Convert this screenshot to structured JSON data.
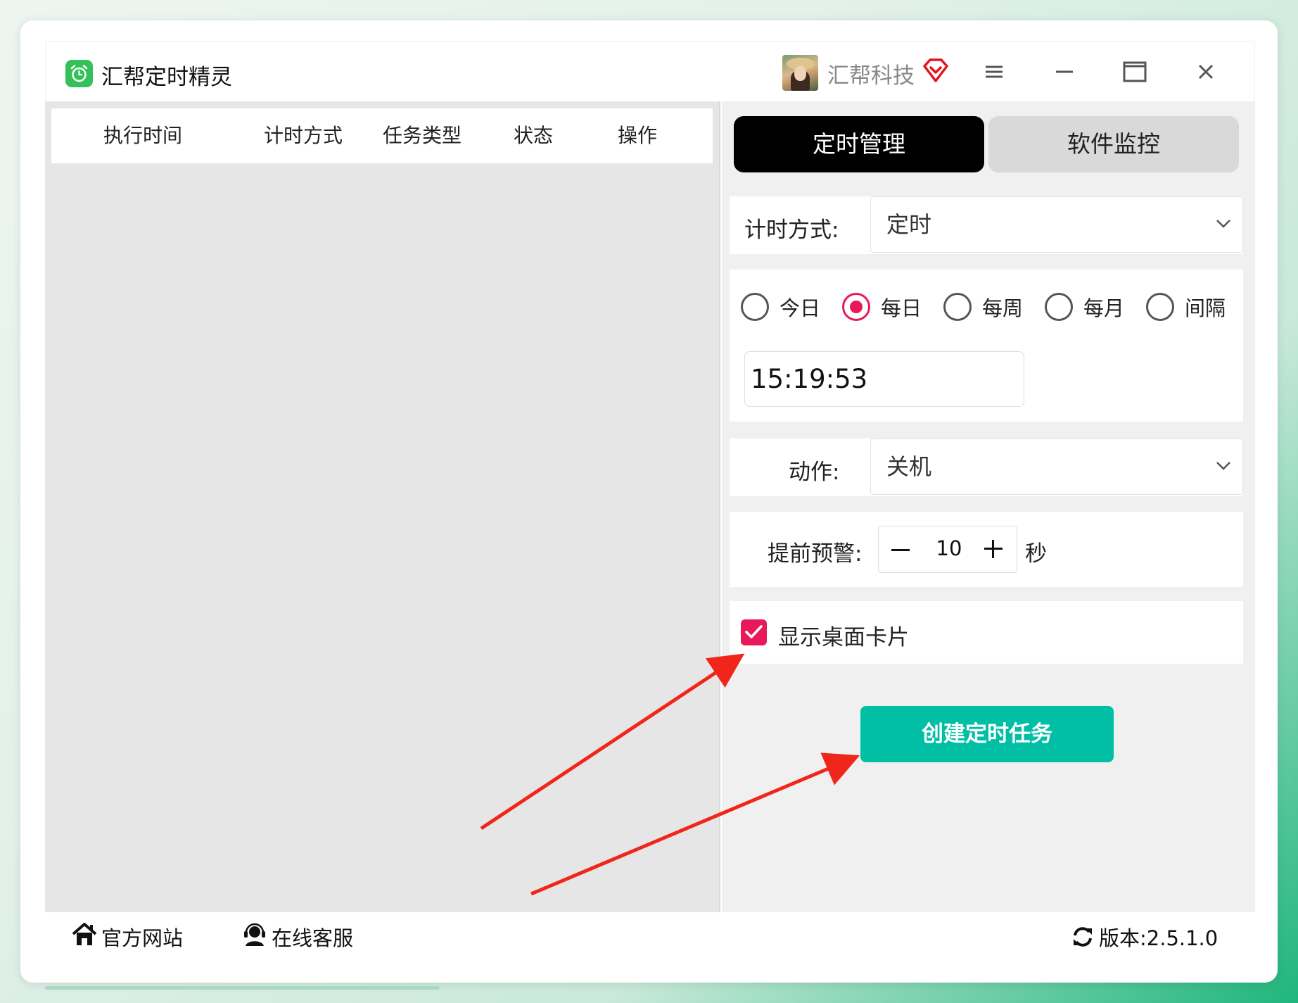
{
  "app": {
    "title": "汇帮定时精灵",
    "user_name": "汇帮科技",
    "icons": {
      "logo": "alarm-clock-icon",
      "vip": "diamond-vip-icon",
      "menu": "hamburger-menu-icon",
      "minimize": "minimize-icon",
      "maximize": "maximize-icon",
      "close": "close-icon"
    }
  },
  "task_table": {
    "columns": [
      "执行时间",
      "计时方式",
      "任务类型",
      "状态",
      "操作"
    ],
    "rows": []
  },
  "tabs": [
    {
      "label": "定时管理",
      "active": true
    },
    {
      "label": "软件监控",
      "active": false
    }
  ],
  "form": {
    "timing_label": "计时方式:",
    "timing_value": "定时",
    "repeat_options": [
      {
        "label": "今日",
        "selected": false
      },
      {
        "label": "每日",
        "selected": true
      },
      {
        "label": "每周",
        "selected": false
      },
      {
        "label": "每月",
        "selected": false
      },
      {
        "label": "间隔",
        "selected": false
      }
    ],
    "time_value": "15:19:53",
    "action_label": "动作:",
    "action_value": "关机",
    "warning_label": "提前预警:",
    "warning_value": "10",
    "warning_unit": "秒",
    "show_card_label": "显示桌面卡片",
    "show_card_checked": true,
    "create_button": "创建定时任务"
  },
  "footer": {
    "website": "官方网站",
    "support": "在线客服",
    "version": "版本:2.5.1.0"
  },
  "colors": {
    "accent": "#e8195a",
    "primary_button": "#00bfa5",
    "tab_active": "#000000",
    "annotation_arrow": "#f0261b"
  }
}
